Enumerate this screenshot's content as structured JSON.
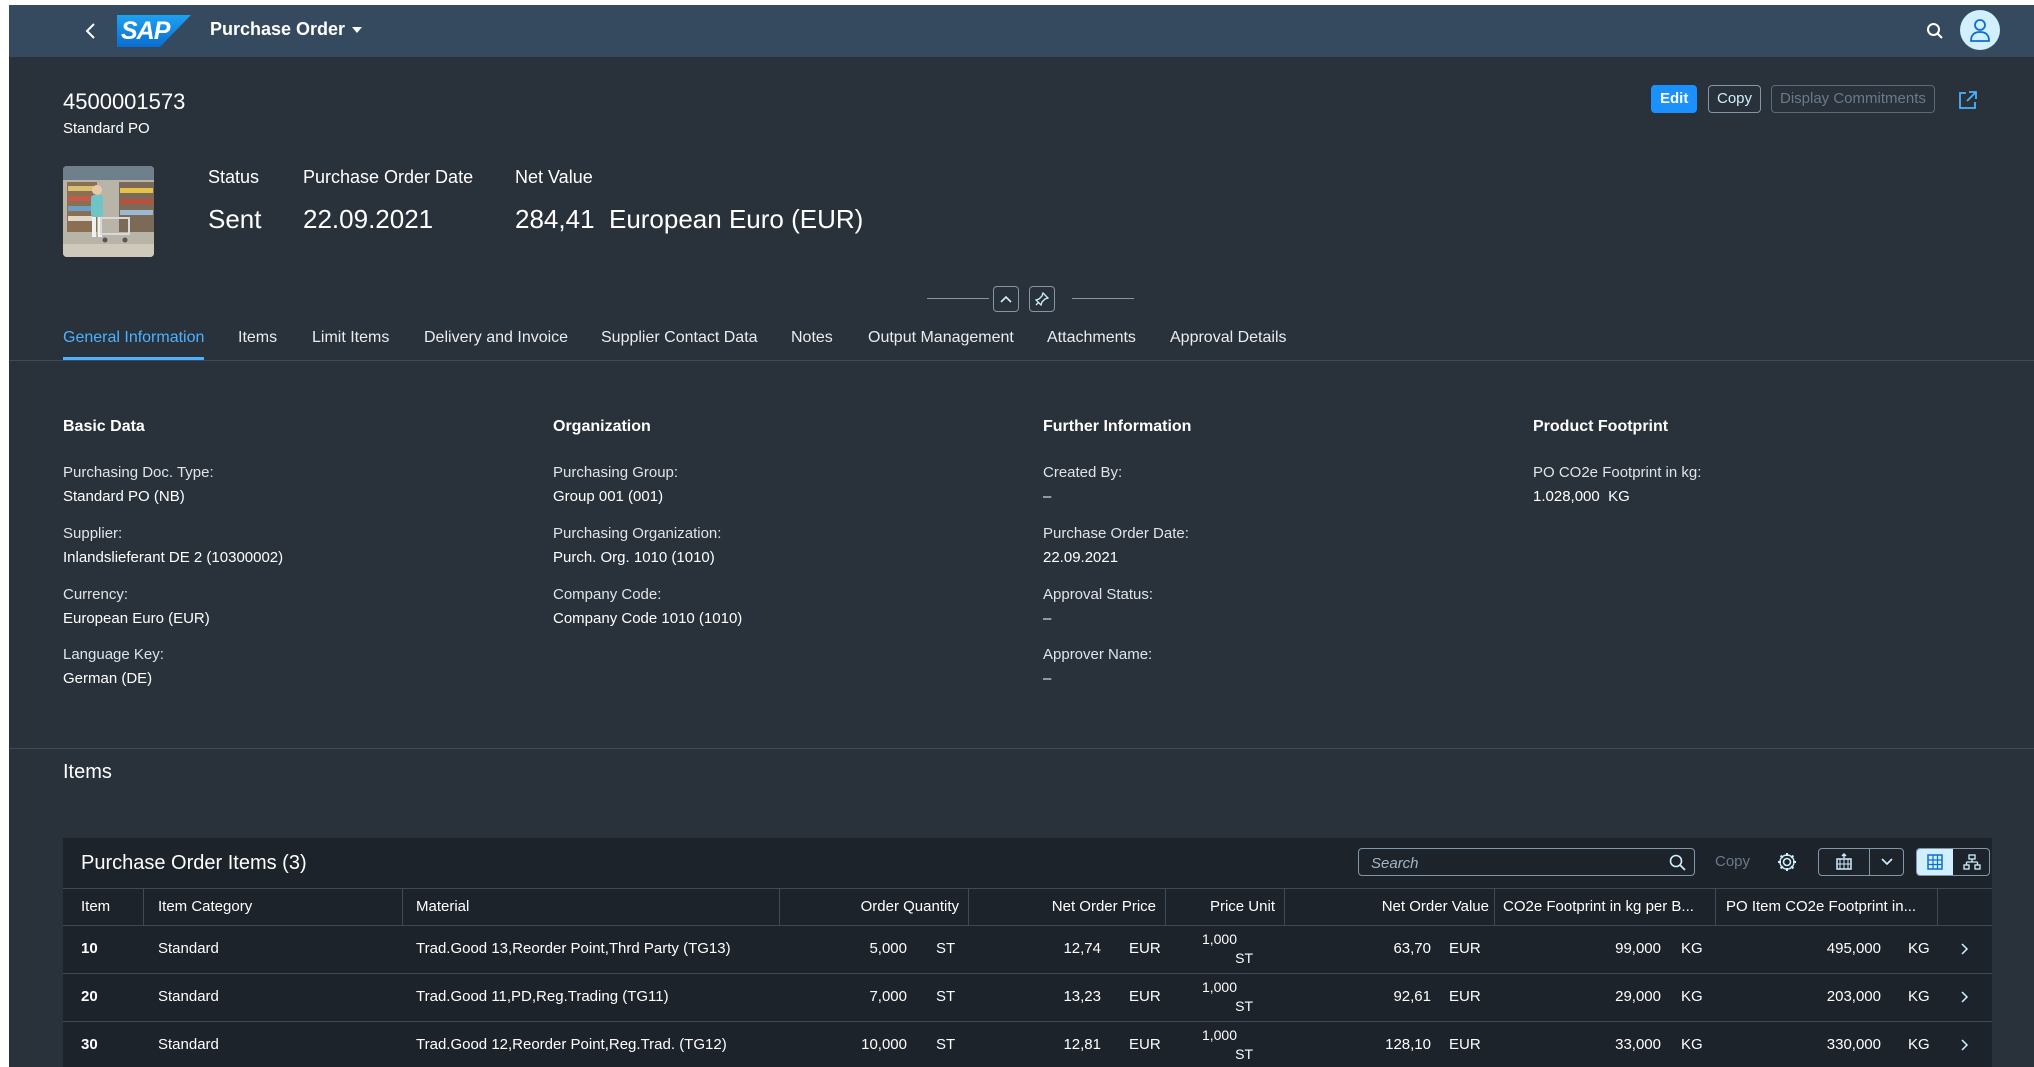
{
  "shell": {
    "logo_text": "SAP",
    "app_title": "Purchase Order",
    "back_icon": "chevron-left-icon",
    "search_icon": "search-icon",
    "user_icon": "person-icon"
  },
  "header": {
    "po_number": "4500001573",
    "po_type": "Standard PO",
    "actions": {
      "edit": "Edit",
      "copy": "Copy",
      "display_commitments": "Display Commitments"
    },
    "kpis": [
      {
        "label": "Status",
        "value": "Sent"
      },
      {
        "label": "Purchase Order Date",
        "value": "22.09.2021"
      },
      {
        "label": "Net Value",
        "value": "284,41  European Euro (EUR)"
      }
    ]
  },
  "tabs": [
    "General Information",
    "Items",
    "Limit Items",
    "Delivery and Invoice",
    "Supplier Contact Data",
    "Notes",
    "Output Management",
    "Attachments",
    "Approval Details"
  ],
  "active_tab": "General Information",
  "general": {
    "basic": {
      "title": "Basic Data",
      "fields": [
        {
          "label": "Purchasing Doc. Type:",
          "value": "Standard PO (NB)"
        },
        {
          "label": "Supplier:",
          "value": "Inlandslieferant DE 2 (10300002)"
        },
        {
          "label": "Currency:",
          "value": "European Euro (EUR)"
        },
        {
          "label": "Language Key:",
          "value": "German (DE)"
        }
      ]
    },
    "organization": {
      "title": "Organization",
      "fields": [
        {
          "label": "Purchasing Group:",
          "value": "Group 001 (001)"
        },
        {
          "label": "Purchasing Organization:",
          "value": "Purch. Org. 1010 (1010)"
        },
        {
          "label": "Company Code:",
          "value": "Company Code 1010 (1010)"
        }
      ]
    },
    "further": {
      "title": "Further Information",
      "fields": [
        {
          "label": "Created By:",
          "value": "–"
        },
        {
          "label": "Purchase Order Date:",
          "value": "22.09.2021"
        },
        {
          "label": "Approval Status:",
          "value": "–"
        },
        {
          "label": "Approver Name:",
          "value": "–"
        }
      ]
    },
    "footprint": {
      "title": "Product Footprint",
      "fields": [
        {
          "label": "PO CO2e Footprint in kg:",
          "value": "1.028,000  KG"
        }
      ]
    }
  },
  "items_section": {
    "heading": "Items",
    "table_title": "Purchase Order Items (3)",
    "search_placeholder": "Search",
    "copy_label": "Copy",
    "columns": [
      "Item",
      "Item Category",
      "Material",
      "Order Quantity",
      "Net Order Price",
      "Price Unit",
      "Net Order Value",
      "CO2e Footprint in kg per B...",
      "PO Item CO2e Footprint in..."
    ],
    "rows": [
      {
        "item": "10",
        "category": "Standard",
        "material": "Trad.Good 13,Reorder Point,Thrd Party (TG13)",
        "qty": "5,000",
        "qty_unit": "ST",
        "price": "12,74",
        "price_cur": "EUR",
        "pu_qty": "1,000",
        "pu_unit": "ST",
        "value": "63,70",
        "value_cur": "EUR",
        "co2_per": "99,000",
        "co2_per_unit": "KG",
        "co2_item": "495,000",
        "co2_item_unit": "KG"
      },
      {
        "item": "20",
        "category": "Standard",
        "material": "Trad.Good 11,PD,Reg.Trading (TG11)",
        "qty": "7,000",
        "qty_unit": "ST",
        "price": "13,23",
        "price_cur": "EUR",
        "pu_qty": "1,000",
        "pu_unit": "ST",
        "value": "92,61",
        "value_cur": "EUR",
        "co2_per": "29,000",
        "co2_per_unit": "KG",
        "co2_item": "203,000",
        "co2_item_unit": "KG"
      },
      {
        "item": "30",
        "category": "Standard",
        "material": "Trad.Good 12,Reorder Point,Reg.Trad. (TG12)",
        "qty": "10,000",
        "qty_unit": "ST",
        "price": "12,81",
        "price_cur": "EUR",
        "pu_qty": "1,000",
        "pu_unit": "ST",
        "value": "128,10",
        "value_cur": "EUR",
        "co2_per": "33,000",
        "co2_per_unit": "KG",
        "co2_item": "330,000",
        "co2_item_unit": "KG"
      }
    ]
  },
  "colors": {
    "shell_bg": "#354a5f",
    "page_bg": "#29313a",
    "table_bg": "#1d232a",
    "accent": "#1b90ff",
    "active_tab": "#4db1ff"
  }
}
